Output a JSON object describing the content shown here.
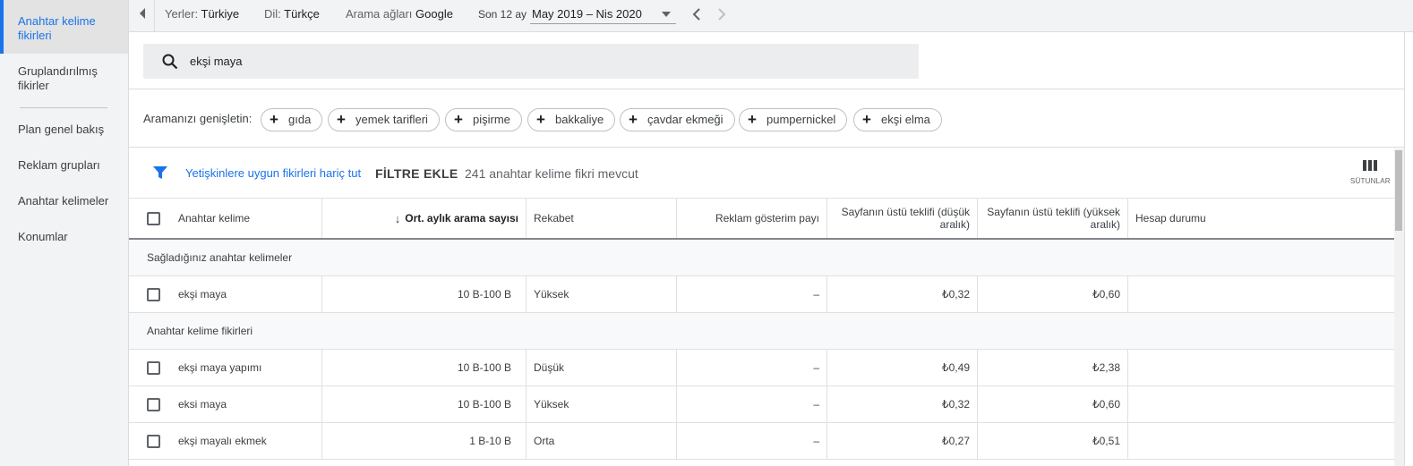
{
  "sidebar": {
    "items": [
      {
        "label": "Anahtar kelime fikirleri",
        "active": true
      },
      {
        "label": "Gruplandırılmış fikirler",
        "active": false
      },
      {
        "label": "Plan genel bakış",
        "active": false
      },
      {
        "label": "Reklam grupları",
        "active": false
      },
      {
        "label": "Anahtar kelimeler",
        "active": false
      },
      {
        "label": "Konumlar",
        "active": false
      }
    ]
  },
  "topbar": {
    "locations_label": "Yerler:",
    "locations_value": "Türkiye",
    "language_label": "Dil:",
    "language_value": "Türkçe",
    "network_label": "Arama ağları",
    "network_value": "Google",
    "period_label": "Son 12 ay",
    "date_range": "May 2019 – Nis 2020"
  },
  "search": {
    "query": "ekşi maya"
  },
  "broaden": {
    "label": "Aramanızı genişletin:",
    "chips": [
      "gıda",
      "yemek tarifleri",
      "pişirme",
      "bakkaliye",
      "çavdar ekmeği",
      "pumpernickel",
      "ekşi elma"
    ]
  },
  "filterbar": {
    "exclude_adult": "Yetişkinlere uygun fikirleri hariç tut",
    "add_filter": "FİLTRE EKLE",
    "count_text": "241 anahtar kelime fikri mevcut",
    "columns_label": "SÜTUNLAR"
  },
  "table": {
    "headers": {
      "keyword": "Anahtar kelime",
      "avg_searches": "Ort. aylık arama sayısı",
      "competition": "Rekabet",
      "impression_share": "Reklam gösterim payı",
      "top_bid_low": "Sayfanın üstü teklifi (düşük aralık)",
      "top_bid_high": "Sayfanın üstü teklifi (yüksek aralık)",
      "account_status": "Hesap durumu"
    },
    "provided_section": "Sağladığınız anahtar kelimeler",
    "provided_rows": [
      {
        "keyword": "ekşi maya",
        "searches": "10 B-100 B",
        "competition": "Yüksek",
        "share": "–",
        "low": "₺0,32",
        "high": "₺0,60",
        "status": ""
      }
    ],
    "ideas_section": "Anahtar kelime fikirleri",
    "idea_rows": [
      {
        "keyword": "ekşi maya yapımı",
        "searches": "10 B-100 B",
        "competition": "Düşük",
        "share": "–",
        "low": "₺0,49",
        "high": "₺2,38",
        "status": ""
      },
      {
        "keyword": "eksi maya",
        "searches": "10 B-100 B",
        "competition": "Yüksek",
        "share": "–",
        "low": "₺0,32",
        "high": "₺0,60",
        "status": ""
      },
      {
        "keyword": "ekşi mayalı ekmek",
        "searches": "1 B-10 B",
        "competition": "Orta",
        "share": "–",
        "low": "₺0,27",
        "high": "₺0,51",
        "status": ""
      }
    ]
  },
  "colors": {
    "accent": "#1a73e8",
    "sidebar_bg": "#f1f3f4"
  }
}
